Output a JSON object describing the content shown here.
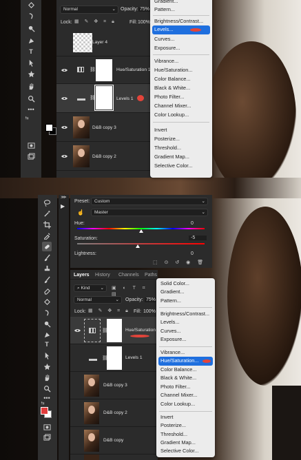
{
  "top": {
    "blend_mode": "Normal",
    "opacity_label": "Opacity:",
    "opacity_value": "75%",
    "lock_label": "Lock:",
    "fill_label": "Fill:",
    "fill_value": "100%",
    "layers": [
      {
        "name": "Layer 4"
      },
      {
        "name": "Hue/Saturation 1"
      },
      {
        "name": "Levels 1"
      },
      {
        "name": "D&B copy 3"
      },
      {
        "name": "D&B copy 2"
      }
    ],
    "menu": {
      "items": [
        "Gradient...",
        "Pattern...",
        "Brightness/Contrast...",
        "Levels...",
        "Curves...",
        "Exposure...",
        "Vibrance...",
        "Hue/Saturation...",
        "Color Balance...",
        "Black & White...",
        "Photo Filter...",
        "Channel Mixer...",
        "Color Lookup...",
        "Invert",
        "Posterize...",
        "Threshold...",
        "Gradient Map...",
        "Selective Color..."
      ],
      "selected": "Levels..."
    }
  },
  "bottom": {
    "properties": {
      "preset_label": "Preset:",
      "preset_value": "Custom",
      "channel_value": "Master",
      "hue_label": "Hue:",
      "hue_value": "0",
      "hue_fraction": 0.5,
      "saturation_label": "Saturation:",
      "saturation_value": "-5",
      "saturation_fraction": 0.475,
      "lightness_label": "Lightness:",
      "lightness_value": "0"
    },
    "tabs": [
      "Layers",
      "History",
      "Channels",
      "Paths"
    ],
    "kind_label": "Kind",
    "blend_mode": "Normal",
    "opacity_label": "Opacity:",
    "opacity_value": "75%",
    "lock_label": "Lock:",
    "fill_label": "Fill:",
    "fill_value": "100%",
    "layers": [
      {
        "name": "Hue/Saturation 1"
      },
      {
        "name": "Levels 1"
      },
      {
        "name": "D&B copy 3"
      },
      {
        "name": "D&B copy 2"
      },
      {
        "name": "D&B copy"
      }
    ],
    "menu": {
      "items": [
        "Solid Color...",
        "Gradient...",
        "Pattern...",
        "Brightness/Contrast...",
        "Levels...",
        "Curves...",
        "Exposure...",
        "Vibrance...",
        "Hue/Saturation...",
        "Color Balance...",
        "Black & White...",
        "Photo Filter...",
        "Channel Mixer...",
        "Color Lookup...",
        "Invert",
        "Posterize...",
        "Threshold...",
        "Gradient Map...",
        "Selective Color..."
      ],
      "selected": "Hue/Saturation..."
    }
  },
  "colors": {
    "highlight": "#1f6fde",
    "annotation": "#e3443a",
    "foreground_bottom": "#e03c3c"
  }
}
